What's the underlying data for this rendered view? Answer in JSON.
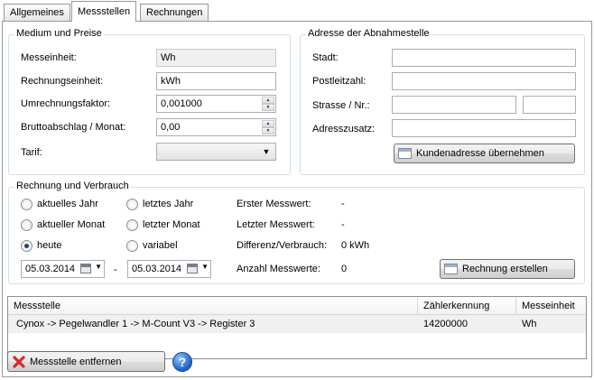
{
  "tabs": [
    "Allgemeines",
    "Messstellen",
    "Rechnungen"
  ],
  "active_tab": "Messstellen",
  "medium": {
    "title": "Medium und Preise",
    "messeinheit_label": "Messeinheit:",
    "messeinheit_value": "Wh",
    "rechnungseinheit_label": "Rechnungseinheit:",
    "rechnungseinheit_value": "kWh",
    "umrechnungsfaktor_label": "Umrechnungsfaktor:",
    "umrechnungsfaktor_value": "0,001000",
    "bruttoabschlag_label": "Bruttoabschlag / Monat:",
    "bruttoabschlag_value": "0,00",
    "tarif_label": "Tarif:",
    "tarif_value": ""
  },
  "adresse": {
    "title": "Adresse der Abnahmestelle",
    "stadt_label": "Stadt:",
    "stadt_value": "",
    "plz_label": "Postleitzahl:",
    "plz_value": "",
    "strasse_label": "Strasse / Nr.:",
    "strasse_value": "",
    "nr_value": "",
    "zusatz_label": "Adresszusatz:",
    "zusatz_value": "",
    "uebernehmen_button": "Kundenadresse übernehmen"
  },
  "rechnung": {
    "title": "Rechnung und Verbrauch",
    "radio_aktuelles_jahr": "aktuelles Jahr",
    "radio_letztes_jahr": "letztes Jahr",
    "radio_aktueller_monat": "aktueller Monat",
    "radio_letzter_monat": "letzter Monat",
    "radio_heute": "heute",
    "radio_variabel": "variabel",
    "selected_radio": "heute",
    "date_from": "05.03.2014",
    "date_to": "05.03.2014",
    "date_separator": "-",
    "erster_label": "Erster Messwert:",
    "erster_value": "-",
    "letzter_label": "Letzter Messwert:",
    "letzter_value": "-",
    "differenz_label": "Differenz/Verbrauch:",
    "differenz_value": "0 kWh",
    "anzahl_label": "Anzahl Messwerte:",
    "anzahl_value": "0",
    "erstellen_button": "Rechnung erstellen"
  },
  "table": {
    "columns": [
      "Messstelle",
      "Zählerkennung",
      "Messeinheit"
    ],
    "rows": [
      [
        "Cynox -> Pegelwandler 1 -> M-Count V3 -> Register 3",
        "14200000",
        "Wh"
      ]
    ]
  },
  "footer": {
    "entfernen_button": "Messstelle entfernen",
    "help_icon": "help-icon",
    "help_glyph": "?"
  },
  "colors": {
    "selected_row": "#f0f0f0",
    "group_border": "#d5dfe5",
    "delete_icon": "#d42a2a"
  }
}
